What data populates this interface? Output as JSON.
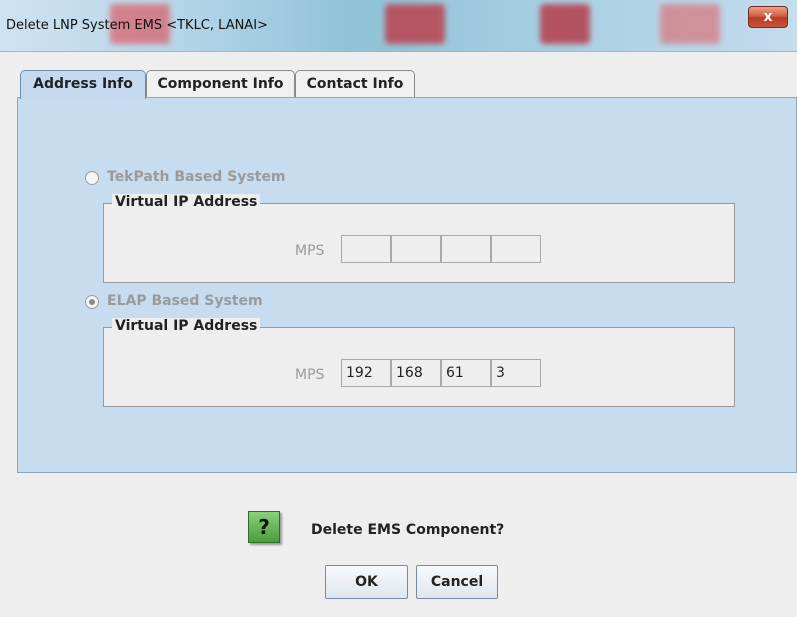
{
  "window": {
    "title": "Delete LNP System EMS <TKLC, LANAI>",
    "close_label": "x"
  },
  "tabs": [
    {
      "label": "Address Info",
      "active": true
    },
    {
      "label": "Component Info",
      "active": false
    },
    {
      "label": "Contact Info",
      "active": false
    }
  ],
  "tekpath": {
    "radio_label": "TekPath Based System",
    "selected": false,
    "group_title": "Virtual IP Address",
    "mps_label": "MPS",
    "ip": [
      "",
      "",
      "",
      ""
    ]
  },
  "elap": {
    "radio_label": "ELAP Based System",
    "selected": true,
    "group_title": "Virtual IP Address",
    "mps_label": "MPS",
    "ip": [
      "192",
      "168",
      "61",
      "3"
    ]
  },
  "confirm": {
    "icon_glyph": "?",
    "question": "Delete EMS Component?",
    "ok_label": "OK",
    "cancel_label": "Cancel"
  }
}
